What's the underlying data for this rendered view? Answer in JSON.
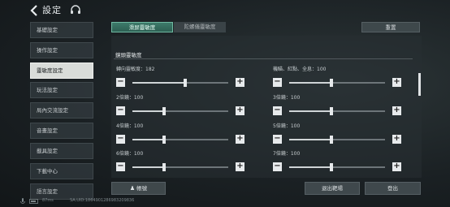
{
  "header": {
    "title": "設定"
  },
  "sidebar": {
    "items": [
      {
        "label": "基礎設定"
      },
      {
        "label": "操作設定"
      },
      {
        "label": "靈敏度設定"
      },
      {
        "label": "玩法設定"
      },
      {
        "label": "局內交流設定"
      },
      {
        "label": "音畫設定"
      },
      {
        "label": "載具設定"
      },
      {
        "label": "下載中心"
      },
      {
        "label": "語言設定"
      }
    ],
    "active_index": 2
  },
  "tabs": [
    {
      "label": "滑屏靈敏度"
    },
    {
      "label": "陀螺儀靈敏度"
    }
  ],
  "reset_label": "重置",
  "section": {
    "title": "鏡頭靈敏度"
  },
  "sliders": [
    {
      "label": "轉向靈敏度：182",
      "fraction": 0.55
    },
    {
      "label": "機瞄、紅點、全息：100",
      "fraction": 0.44
    },
    {
      "label": "2倍鏡：100",
      "fraction": 0.33
    },
    {
      "label": "3倍鏡：100",
      "fraction": 0.44
    },
    {
      "label": "4倍鏡：100",
      "fraction": 0.33
    },
    {
      "label": "5倍鏡：100",
      "fraction": 0.44
    },
    {
      "label": "6倍鏡：100",
      "fraction": 0.33
    },
    {
      "label": "7倍鏡：100",
      "fraction": 0.44
    }
  ],
  "buttons": {
    "account": "帳號",
    "exit_range": "退出靶場",
    "logout": "登出"
  },
  "footer": {
    "ping": "87ms",
    "uid": "SA.UID:1864901286983209836"
  }
}
